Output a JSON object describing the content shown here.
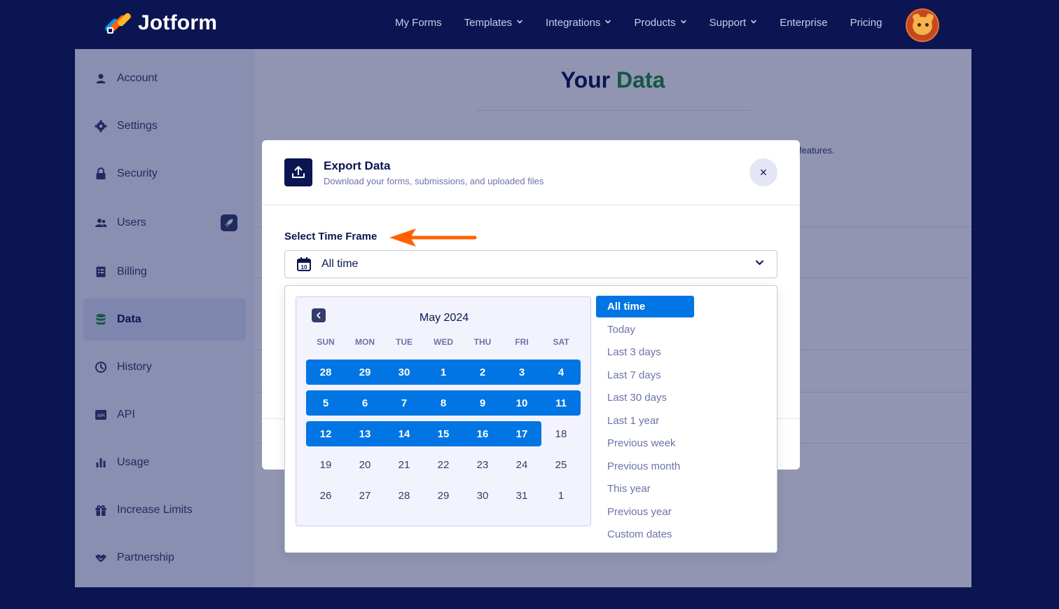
{
  "nav": {
    "brand": "Jotform",
    "items": [
      {
        "label": "My Forms",
        "has_menu": false
      },
      {
        "label": "Templates",
        "has_menu": true
      },
      {
        "label": "Integrations",
        "has_menu": true
      },
      {
        "label": "Products",
        "has_menu": true
      },
      {
        "label": "Support",
        "has_menu": true
      },
      {
        "label": "Enterprise",
        "has_menu": false
      },
      {
        "label": "Pricing",
        "has_menu": false
      }
    ]
  },
  "sidebar": {
    "items": [
      {
        "label": "Account",
        "icon": "user-icon"
      },
      {
        "label": "Settings",
        "icon": "gear-icon"
      },
      {
        "label": "Security",
        "icon": "lock-icon"
      },
      {
        "label": "Users",
        "icon": "users-icon"
      },
      {
        "label": "Billing",
        "icon": "billing-icon"
      },
      {
        "label": "Data",
        "icon": "database-icon",
        "active": true
      },
      {
        "label": "History",
        "icon": "history-icon"
      },
      {
        "label": "API",
        "icon": "api-icon"
      },
      {
        "label": "Usage",
        "icon": "chart-icon"
      },
      {
        "label": "Increase Limits",
        "icon": "gift-icon"
      },
      {
        "label": "Partnership",
        "icon": "handshake-icon"
      }
    ]
  },
  "page": {
    "title_part1": "Your",
    "title_part2": "Data",
    "features_text": "features."
  },
  "modal": {
    "title": "Export Data",
    "subtitle": "Download your forms, submissions, and uploaded files",
    "close_label": "×",
    "timeframe_label": "Select Time Frame",
    "selected_value": "All time",
    "calendar_icon_day": "10"
  },
  "calendar": {
    "month_label": "May 2024",
    "weekdays": [
      "SUN",
      "MON",
      "TUE",
      "WED",
      "THU",
      "FRI",
      "SAT"
    ],
    "weeks": [
      [
        "28",
        "29",
        "30",
        "1",
        "2",
        "3",
        "4"
      ],
      [
        "5",
        "6",
        "7",
        "8",
        "9",
        "10",
        "11"
      ],
      [
        "12",
        "13",
        "14",
        "15",
        "16",
        "17",
        "18"
      ],
      [
        "19",
        "20",
        "21",
        "22",
        "23",
        "24",
        "25"
      ],
      [
        "26",
        "27",
        "28",
        "29",
        "30",
        "31",
        "1"
      ]
    ],
    "selected_count_per_week": [
      7,
      7,
      6,
      0,
      0
    ]
  },
  "presets": [
    {
      "label": "All time",
      "active": true
    },
    {
      "label": "Today"
    },
    {
      "label": "Last 3 days"
    },
    {
      "label": "Last 7 days"
    },
    {
      "label": "Last 30 days"
    },
    {
      "label": "Last 1 year"
    },
    {
      "label": "Previous week"
    },
    {
      "label": "Previous month"
    },
    {
      "label": "This year"
    },
    {
      "label": "Previous year"
    },
    {
      "label": "Custom dates"
    }
  ],
  "colors": {
    "navy": "#0a1551",
    "accent_blue": "#0075e3",
    "green": "#1b8f3a",
    "arrow_orange": "#ff6100"
  }
}
